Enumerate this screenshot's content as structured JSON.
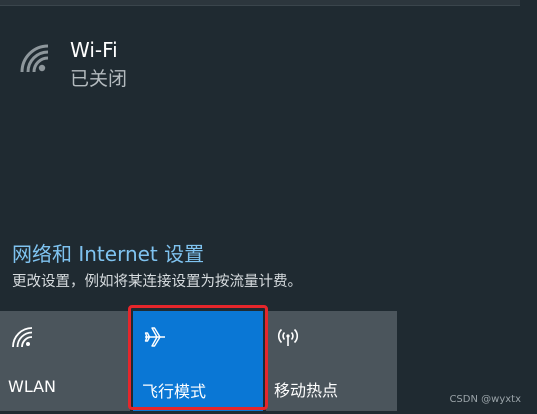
{
  "wifi": {
    "title": "Wi-Fi",
    "status": "已关闭",
    "icon": "wifi-icon"
  },
  "network_settings": {
    "link": "网络和 Internet 设置",
    "description": "更改设置，例如将某连接设置为按流量计费。"
  },
  "quick_actions": [
    {
      "label": "WLAN",
      "icon": "wifi-icon",
      "active": false
    },
    {
      "label": "飞行模式",
      "icon": "airplane-icon",
      "active": true
    },
    {
      "label": "移动热点",
      "icon": "hotspot-icon",
      "active": false
    }
  ],
  "colors": {
    "background": "#1f2a31",
    "accent": "#0a77d5",
    "tile": "#4b555c",
    "link": "#7fc3f0",
    "highlight": "#e6262b"
  },
  "watermark": "CSDN @wyxtx"
}
